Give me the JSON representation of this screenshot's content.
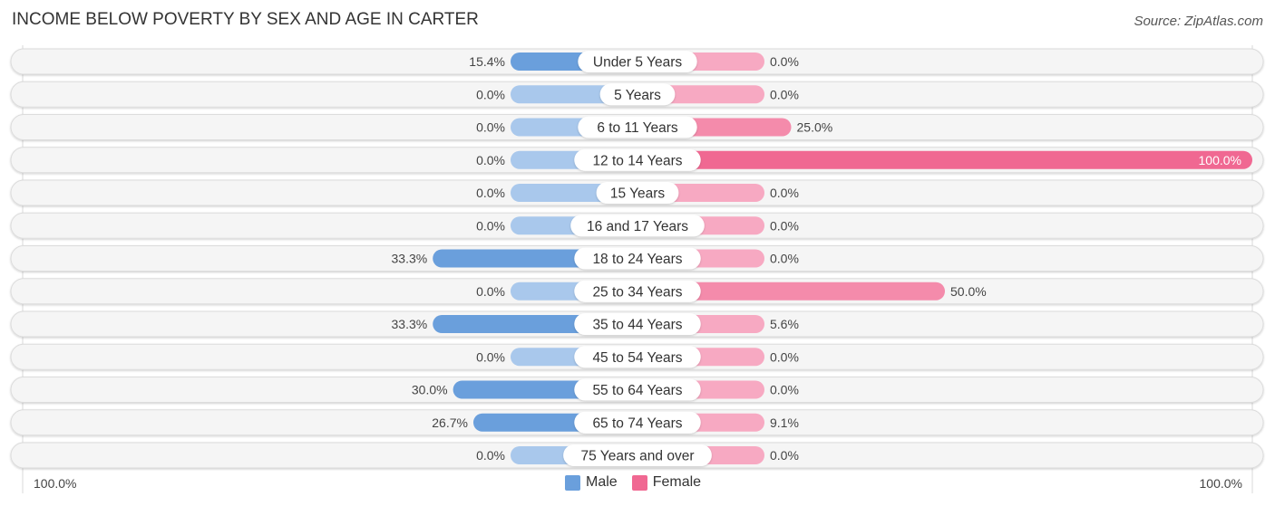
{
  "header": {
    "title": "INCOME BELOW POVERTY BY SEX AND AGE IN CARTER",
    "source": "Source: ZipAtlas.com"
  },
  "colors": {
    "male_full": "#6a9fdc",
    "male_light": "#a9c8ec",
    "female_full": "#f06892",
    "female_mid": "#f48bab",
    "female_light": "#f7a9c2",
    "row_bg": "#f5f5f5"
  },
  "axis": {
    "left_label": "100.0%",
    "right_label": "100.0%"
  },
  "legend": {
    "items": [
      {
        "label": "Male",
        "color": "#6a9fdc"
      },
      {
        "label": "Female",
        "color": "#f06892"
      }
    ]
  },
  "chart_data": {
    "type": "bar",
    "orientation": "horizontal-diverging",
    "title": "INCOME BELOW POVERTY BY SEX AND AGE IN CARTER",
    "xlabel": "",
    "ylabel": "",
    "xlim": [
      -100,
      100
    ],
    "legend_position": "bottom-center",
    "categories": [
      "Under 5 Years",
      "5 Years",
      "6 to 11 Years",
      "12 to 14 Years",
      "15 Years",
      "16 and 17 Years",
      "18 to 24 Years",
      "25 to 34 Years",
      "35 to 44 Years",
      "45 to 54 Years",
      "55 to 64 Years",
      "65 to 74 Years",
      "75 Years and over"
    ],
    "series": [
      {
        "name": "Male",
        "values": [
          15.4,
          0.0,
          0.0,
          0.0,
          0.0,
          0.0,
          33.3,
          0.0,
          33.3,
          0.0,
          30.0,
          26.7,
          0.0
        ],
        "labels": [
          "15.4%",
          "0.0%",
          "0.0%",
          "0.0%",
          "0.0%",
          "0.0%",
          "33.3%",
          "0.0%",
          "33.3%",
          "0.0%",
          "30.0%",
          "26.7%",
          "0.0%"
        ]
      },
      {
        "name": "Female",
        "values": [
          0.0,
          0.0,
          25.0,
          100.0,
          0.0,
          0.0,
          0.0,
          50.0,
          5.6,
          0.0,
          0.0,
          9.1,
          0.0
        ],
        "labels": [
          "0.0%",
          "0.0%",
          "25.0%",
          "100.0%",
          "0.0%",
          "0.0%",
          "0.0%",
          "50.0%",
          "5.6%",
          "0.0%",
          "0.0%",
          "9.1%",
          "0.0%"
        ]
      }
    ]
  }
}
